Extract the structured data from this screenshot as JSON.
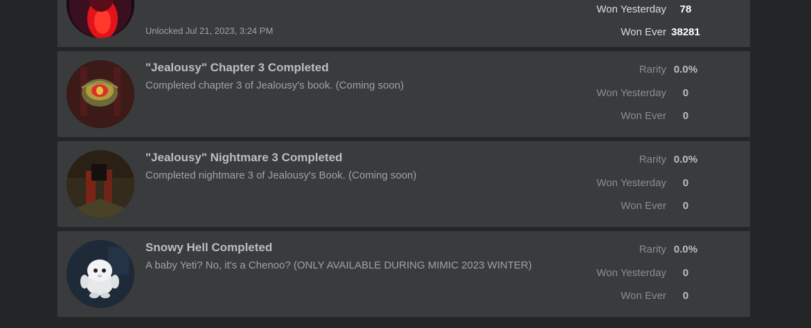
{
  "badges": [
    {
      "unlocked": "Unlocked Jul 21, 2023, 3:24 PM",
      "stats": [
        {
          "label": "Won Yesterday",
          "value": "78"
        },
        {
          "label": "Won Ever",
          "value": "38281"
        }
      ]
    },
    {
      "title": "\"Jealousy\" Chapter 3 Completed",
      "description": "Completed chapter 3 of Jealousy's book. (Coming soon)",
      "stats": [
        {
          "label": "Rarity",
          "value": "0.0%"
        },
        {
          "label": "Won Yesterday",
          "value": "0"
        },
        {
          "label": "Won Ever",
          "value": "0"
        }
      ]
    },
    {
      "title": "\"Jealousy\" Nightmare 3 Completed",
      "description": "Completed nightmare 3 of Jealousy's Book. (Coming soon)",
      "stats": [
        {
          "label": "Rarity",
          "value": "0.0%"
        },
        {
          "label": "Won Yesterday",
          "value": "0"
        },
        {
          "label": "Won Ever",
          "value": "0"
        }
      ]
    },
    {
      "title": "Snowy Hell Completed",
      "description": "A baby Yeti? No, it's a Chenoo? (ONLY AVAILABLE DURING MIMIC 2023 WINTER)",
      "stats": [
        {
          "label": "Rarity",
          "value": "0.0%"
        },
        {
          "label": "Won Yesterday",
          "value": "0"
        },
        {
          "label": "Won Ever",
          "value": "0"
        }
      ]
    }
  ]
}
